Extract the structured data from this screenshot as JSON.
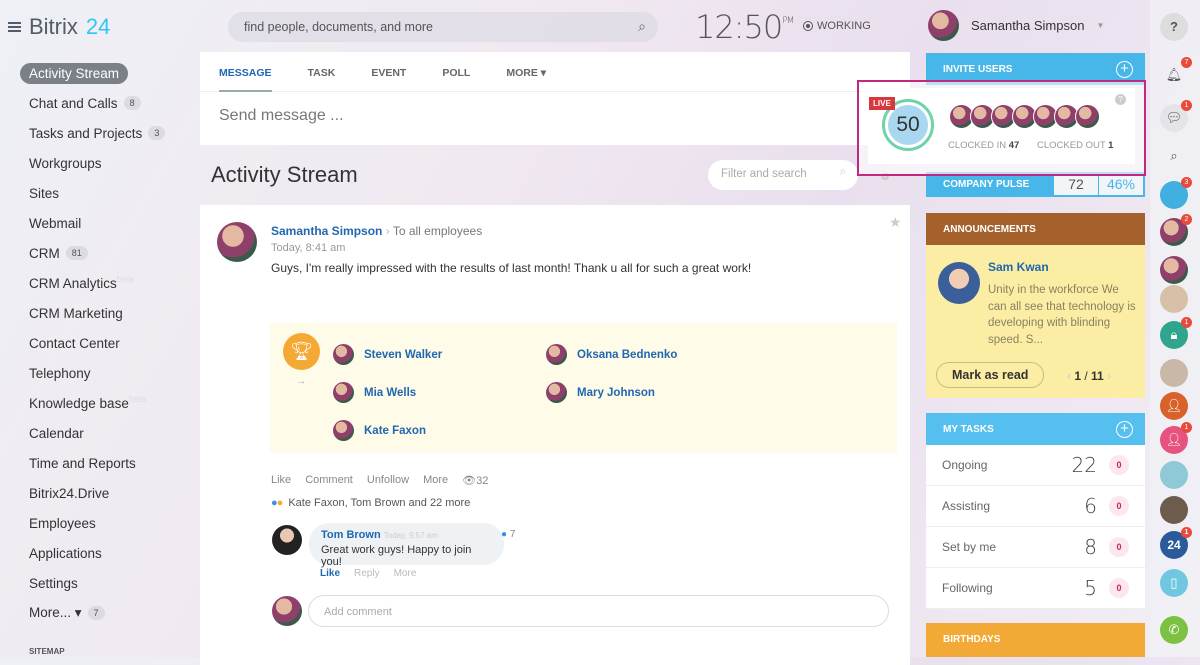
{
  "logo": {
    "name": "Bitrix",
    "num": "24"
  },
  "nav": [
    {
      "label": "Activity Stream",
      "active": true
    },
    {
      "label": "Chat and Calls",
      "count": "8"
    },
    {
      "label": "Tasks and Projects",
      "count": "3"
    },
    {
      "label": "Workgroups"
    },
    {
      "label": "Sites"
    },
    {
      "label": "Webmail"
    },
    {
      "label": "CRM",
      "count": "81"
    },
    {
      "label": "CRM Analytics",
      "beta": "beta"
    },
    {
      "label": "CRM Marketing"
    },
    {
      "label": "Contact Center"
    },
    {
      "label": "Telephony"
    },
    {
      "label": "Knowledge base",
      "beta": "beta"
    },
    {
      "label": "Calendar"
    },
    {
      "label": "Time and Reports"
    },
    {
      "label": "Bitrix24.Drive"
    },
    {
      "label": "Employees"
    },
    {
      "label": "Applications"
    },
    {
      "label": "Settings"
    },
    {
      "label": "More... ▾",
      "count": "7"
    }
  ],
  "sitemap": "SITEMAP",
  "header": {
    "search_placeholder": "find people, documents, and more",
    "time": "12:50",
    "ampm": "PM",
    "status": "WORKING",
    "user": "Samantha Simpson"
  },
  "composer": {
    "tabs": [
      "MESSAGE",
      "TASK",
      "EVENT",
      "POLL",
      "MORE ▾"
    ],
    "placeholder": "Send message ..."
  },
  "stream": {
    "title": "Activity Stream",
    "filter_placeholder": "Filter and search"
  },
  "post": {
    "author": "Samantha Simpson",
    "audience": "To all employees",
    "time": "Today, 8:41 am",
    "text": "Guys, I'm really impressed with the results of last month! Thank u all for such a great work!",
    "recipients": [
      "Steven Walker",
      "Oksana Bednenko",
      "Mia Wells",
      "Mary Johnson",
      "Kate Faxon"
    ],
    "actions": [
      "Like",
      "Comment",
      "Unfollow",
      "More"
    ],
    "views": "32",
    "likes_text": "Kate Faxon, Tom Brown and 22 more",
    "comment": {
      "author": "Tom Brown",
      "time": "Today, 9:57 am",
      "text": "Great work guys! Happy to join you!",
      "likes": "7",
      "actions": [
        "Like",
        "Reply",
        "More"
      ]
    },
    "add_comment": "Add comment"
  },
  "right": {
    "invite": "INVITE USERS",
    "live": {
      "tag": "LIVE",
      "total": "50",
      "clocked_in_label": "CLOCKED IN",
      "clocked_in": "47",
      "clocked_out_label": "CLOCKED OUT",
      "clocked_out": "1"
    },
    "pulse": {
      "label": "COMPANY PULSE",
      "value": "72",
      "percent": "46%"
    },
    "announcements": {
      "title": "ANNOUNCEMENTS",
      "author": "Sam Kwan",
      "text": "Unity in the workforce We can all see that technology is developing with blinding speed. S...",
      "mark": "Mark as read",
      "page": "1",
      "total": "11"
    },
    "tasks": {
      "title": "MY TASKS",
      "rows": [
        {
          "label": "Ongoing",
          "n": "22",
          "z": "0"
        },
        {
          "label": "Assisting",
          "n": "6",
          "z": "0"
        },
        {
          "label": "Set by me",
          "n": "8",
          "z": "0"
        },
        {
          "label": "Following",
          "n": "5",
          "z": "0"
        }
      ]
    },
    "birthdays": "BIRTHDAYS"
  },
  "strip": {
    "notif": "7",
    "chat": "1",
    "b1": "3",
    "b2": "2",
    "lock": "1",
    "crm2": "1",
    "b24": "1"
  }
}
